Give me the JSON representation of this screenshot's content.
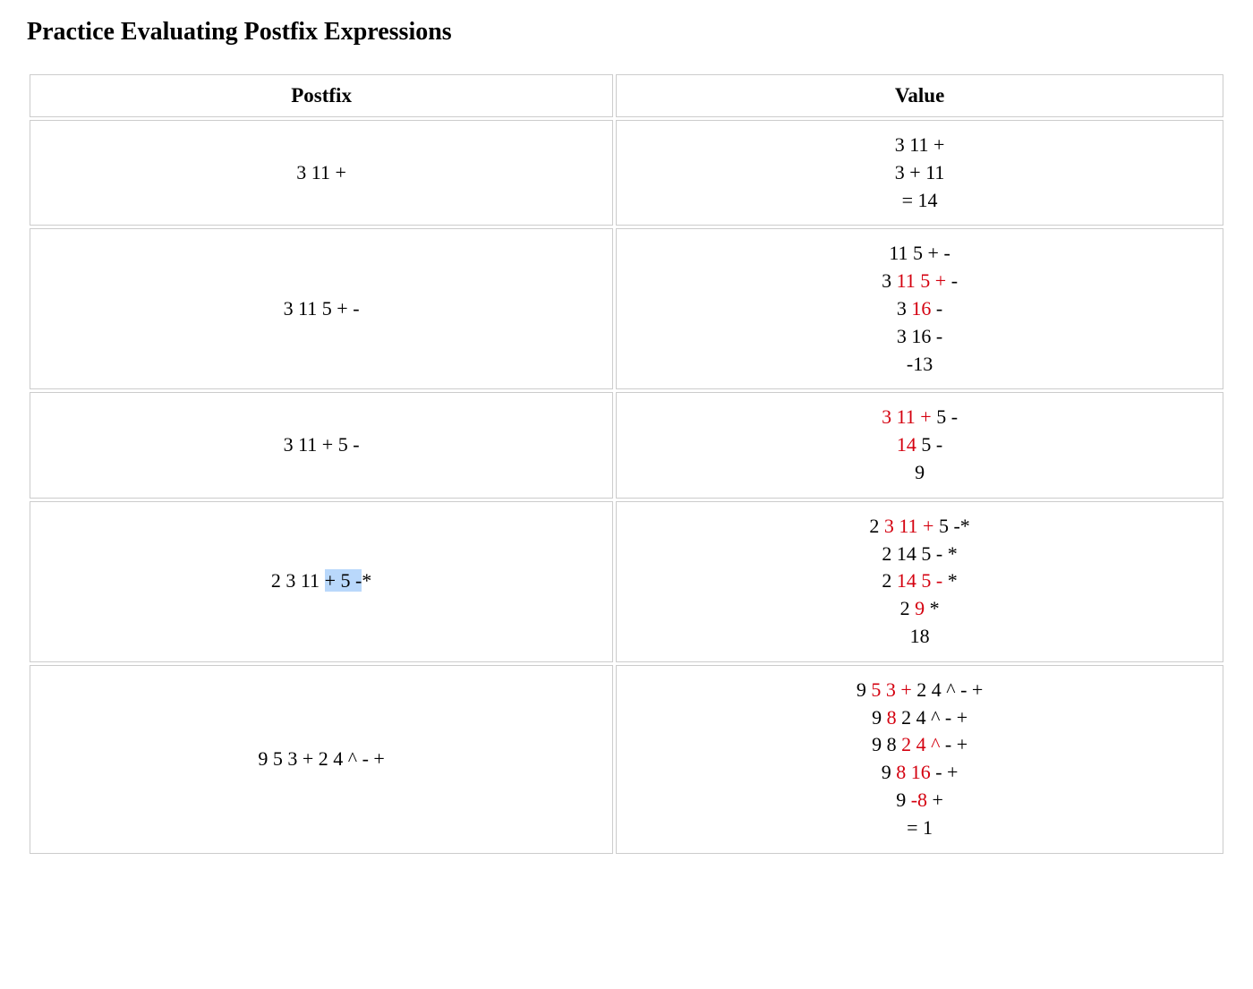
{
  "title": "Practice Evaluating Postfix Expressions",
  "headers": {
    "postfix": "Postfix",
    "value": "Value"
  },
  "rows": [
    {
      "postfix": [
        {
          "segments": [
            {
              "t": "3 11 +"
            }
          ]
        }
      ],
      "value": [
        {
          "segments": [
            {
              "t": "3 11 +"
            }
          ]
        },
        {
          "segments": [
            {
              "t": "3 + 11"
            }
          ]
        },
        {
          "segments": [
            {
              "t": "= 14"
            }
          ]
        }
      ]
    },
    {
      "postfix": [
        {
          "segments": [
            {
              "t": "3 11 5 + -"
            }
          ]
        }
      ],
      "value": [
        {
          "segments": [
            {
              "t": "11 5 + -"
            }
          ]
        },
        {
          "segments": [
            {
              "t": "3 "
            },
            {
              "t": "11 5 +",
              "red": true
            },
            {
              "t": " -"
            }
          ]
        },
        {
          "segments": [
            {
              "t": "3 "
            },
            {
              "t": "16",
              "red": true
            },
            {
              "t": " -"
            }
          ]
        },
        {
          "segments": [
            {
              "t": "3 16 -"
            }
          ]
        },
        {
          "segments": [
            {
              "t": "-13"
            }
          ]
        }
      ]
    },
    {
      "postfix": [
        {
          "segments": [
            {
              "t": "3 11 + 5 -"
            }
          ]
        }
      ],
      "value": [
        {
          "segments": [
            {
              "t": "3 11 +",
              "red": true
            },
            {
              "t": " 5 -"
            }
          ]
        },
        {
          "segments": [
            {
              "t": "14",
              "red": true
            },
            {
              "t": " 5 -"
            }
          ]
        },
        {
          "segments": [
            {
              "t": "9"
            }
          ]
        }
      ]
    },
    {
      "postfix": [
        {
          "segments": [
            {
              "t": "2 3 11 "
            },
            {
              "t": "+ 5 -",
              "sel": true
            },
            {
              "t": "*"
            }
          ]
        }
      ],
      "value": [
        {
          "segments": [
            {
              "t": "2 "
            },
            {
              "t": "3 11 +",
              "red": true
            },
            {
              "t": " 5 -*"
            }
          ]
        },
        {
          "segments": [
            {
              "t": "2 14 5 - *"
            }
          ]
        },
        {
          "segments": [
            {
              "t": "2 "
            },
            {
              "t": "14 5 -",
              "red": true
            },
            {
              "t": " *"
            }
          ]
        },
        {
          "segments": [
            {
              "t": "2 "
            },
            {
              "t": "9",
              "red": true
            },
            {
              "t": " *"
            }
          ]
        },
        {
          "segments": [
            {
              "t": "18"
            }
          ]
        }
      ]
    },
    {
      "postfix": [
        {
          "segments": [
            {
              "t": "9 5 3 + 2 4 ^ - +"
            }
          ]
        }
      ],
      "value": [
        {
          "segments": [
            {
              "t": "9 "
            },
            {
              "t": "5 3 +",
              "red": true
            },
            {
              "t": " 2 4 ^ - +"
            }
          ]
        },
        {
          "segments": [
            {
              "t": "9 "
            },
            {
              "t": "8",
              "red": true
            },
            {
              "t": " 2 4 ^ - +"
            }
          ]
        },
        {
          "segments": [
            {
              "t": "9 8 "
            },
            {
              "t": "2 4 ^",
              "red": true
            },
            {
              "t": " - +"
            }
          ]
        },
        {
          "segments": [
            {
              "t": "9 "
            },
            {
              "t": "8 16",
              "red": true
            },
            {
              "t": " - +"
            }
          ]
        },
        {
          "segments": [
            {
              "t": "9 "
            },
            {
              "t": "-8",
              "red": true
            },
            {
              "t": " +"
            }
          ]
        },
        {
          "segments": [
            {
              "t": "= 1"
            }
          ]
        }
      ]
    }
  ]
}
